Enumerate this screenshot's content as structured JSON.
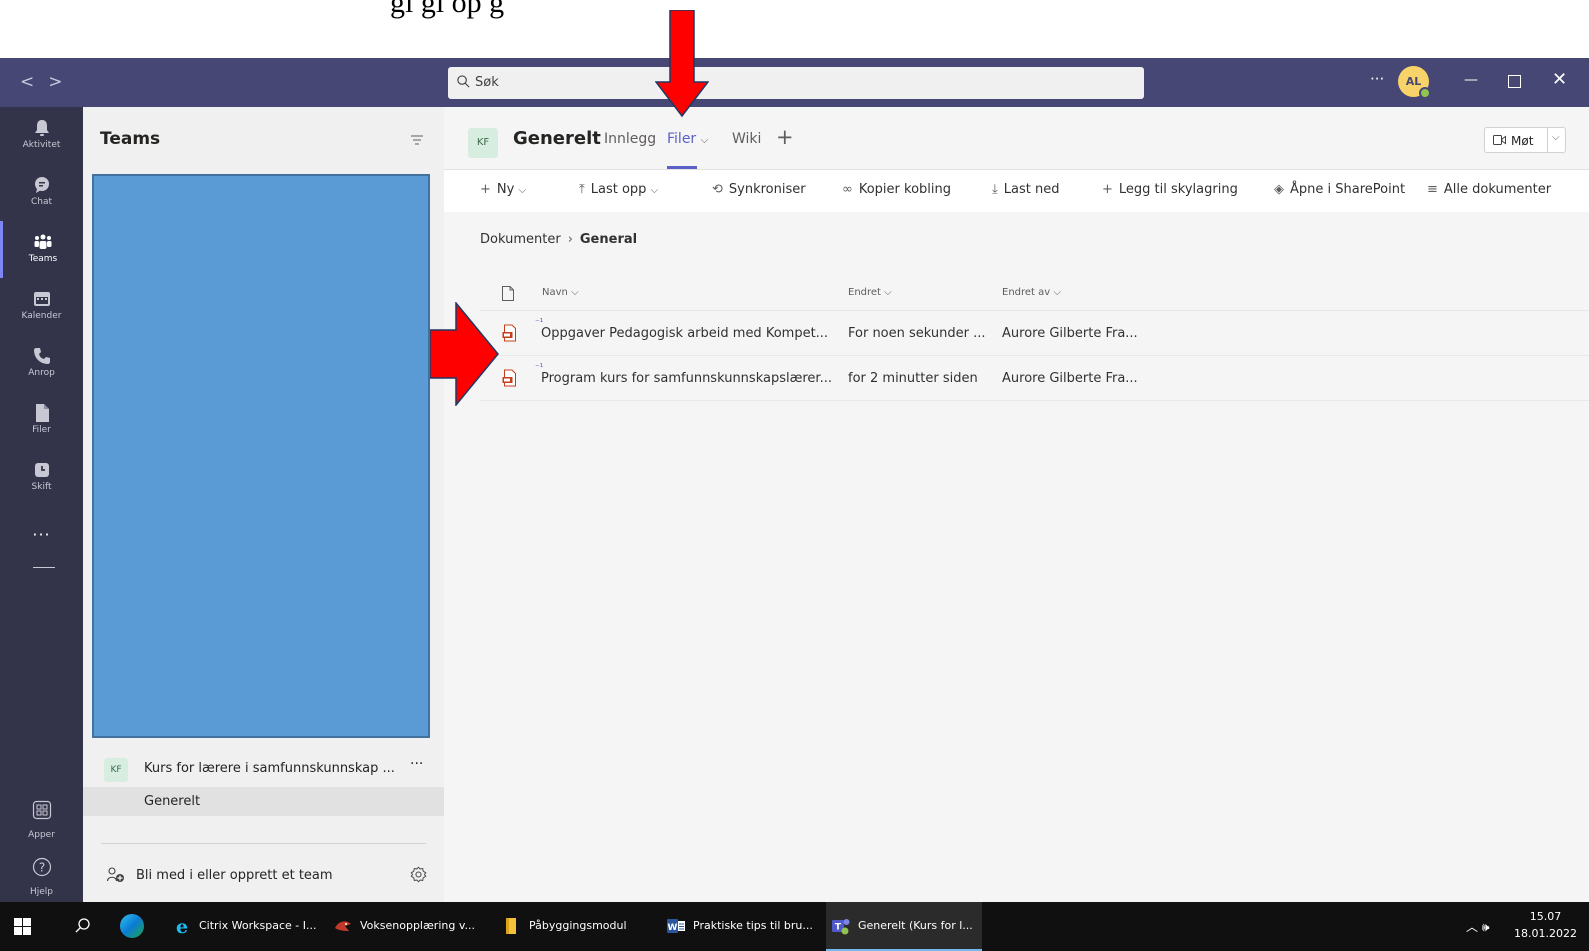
{
  "caption": "gi gi op g",
  "titlebar": {
    "nav_back": "<",
    "nav_forward": ">",
    "search_placeholder": "Søk",
    "more": "···",
    "avatar_initials": "AL"
  },
  "rail": {
    "items": [
      {
        "label": "Aktivitet",
        "icon": "bell-icon"
      },
      {
        "label": "Chat",
        "icon": "chat-icon"
      },
      {
        "label": "Teams",
        "icon": "teams-icon",
        "active": true
      },
      {
        "label": "Kalender",
        "icon": "calendar-icon"
      },
      {
        "label": "Anrop",
        "icon": "phone-icon"
      },
      {
        "label": "Filer",
        "icon": "file-icon"
      },
      {
        "label": "Skift",
        "icon": "clock-icon"
      }
    ],
    "more": "···",
    "apps_label": "Apper",
    "help_label": "Hjelp"
  },
  "teams_panel": {
    "title": "Teams",
    "team_badge": "KF",
    "team_name": "Kurs for lærere i samfunnskunnskap ...",
    "team_more": "···",
    "channel_name": "Generelt",
    "join_label": "Bli med i eller opprett et team"
  },
  "channel": {
    "badge": "KF",
    "name": "Generelt",
    "tabs": [
      {
        "label": "Innlegg",
        "active": false
      },
      {
        "label": "Filer",
        "active": true
      },
      {
        "label": "Wiki",
        "active": false
      }
    ],
    "meet_label": "Møt"
  },
  "commands": {
    "new": "Ny",
    "upload": "Last opp",
    "sync": "Synkroniser",
    "copy_link": "Kopier kobling",
    "download": "Last ned",
    "add_cloud": "Legg til skylagring",
    "open_sharepoint": "Åpne i SharePoint",
    "all_docs": "Alle dokumenter"
  },
  "breadcrumb": {
    "root": "Dokumenter",
    "current": "General"
  },
  "files": {
    "columns": {
      "name": "Navn",
      "modified": "Endret",
      "modified_by": "Endret av"
    },
    "rows": [
      {
        "name": "Oppgaver Pedagogisk arbeid med Kompet...",
        "modified": "For noen sekunder ...",
        "modified_by": "Aurore Gilberte Fra...",
        "type": "pdf"
      },
      {
        "name": "Program kurs for samfunnskunnskapslærer...",
        "modified": "for 2 minutter siden",
        "modified_by": "Aurore Gilberte Fra...",
        "type": "pdf"
      }
    ]
  },
  "taskbar": {
    "items": [
      {
        "label": "Citrix Workspace - I...",
        "icon": "ie-icon"
      },
      {
        "label": "Voksenopplæring v...",
        "icon": "bird-icon"
      },
      {
        "label": "Påbyggingsmodul",
        "icon": "folder-icon"
      },
      {
        "label": "Praktiske tips til bru...",
        "icon": "word-icon"
      },
      {
        "label": "Generelt (Kurs for l...",
        "icon": "teams-app-icon",
        "active": true
      }
    ],
    "time": "15.07",
    "date": "18.01.2022"
  },
  "colors": {
    "titlebar": "#464775",
    "rail": "#33344a",
    "accent": "#5b5fc7",
    "highlight_arrows": "#ff0000",
    "blue_box": "#5b9bd5"
  }
}
